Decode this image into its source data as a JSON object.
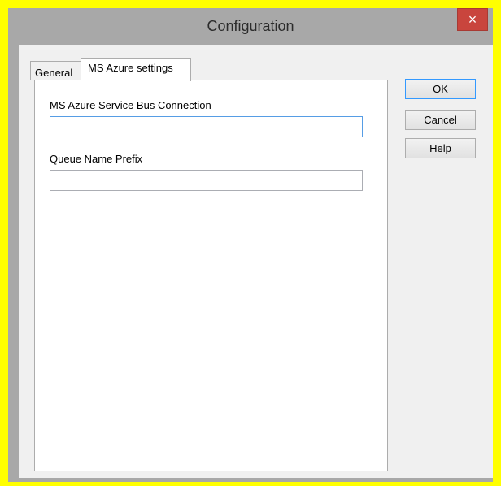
{
  "window": {
    "title": "Configuration",
    "close_glyph": "×"
  },
  "tabs": [
    {
      "label": "General",
      "selected": false
    },
    {
      "label": "MS Azure settings",
      "selected": true
    }
  ],
  "form": {
    "connection": {
      "label": "MS Azure Service Bus Connection",
      "value": ""
    },
    "queue_prefix": {
      "label": "Queue Name Prefix",
      "value": ""
    }
  },
  "buttons": {
    "ok": "OK",
    "cancel": "Cancel",
    "help": "Help"
  },
  "colors": {
    "frame_highlight": "#ffff00",
    "title_bar": "#a8a8a8",
    "close_button": "#c9453d",
    "focus_border": "#569de5"
  }
}
